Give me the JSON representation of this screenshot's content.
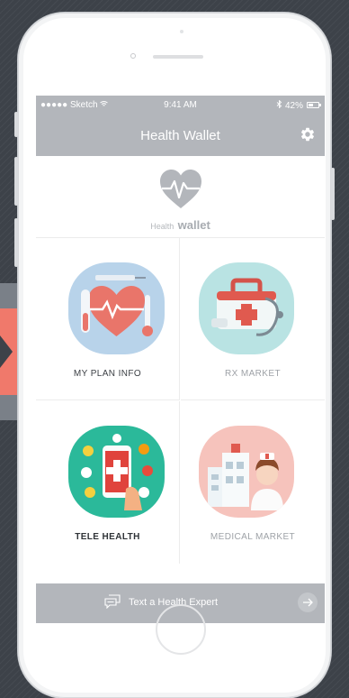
{
  "status_bar": {
    "carrier": "●●●●● Sketch",
    "wifi_icon": "wifi-icon",
    "time": "9:41 AM",
    "battery": "42%"
  },
  "nav": {
    "title": "Health Wallet",
    "settings_icon": "gear-icon"
  },
  "brand": {
    "prefix": "Health",
    "name": "wallet"
  },
  "menu": [
    {
      "label": "MY PLAN INFO",
      "icon": "plan-info-illustration",
      "bg": "#b8d3ea"
    },
    {
      "label": "RX MARKET",
      "icon": "medical-kit-illustration",
      "bg": "#b9e3e3"
    },
    {
      "label": "TELE HEALTH",
      "icon": "telehealth-phone-illustration",
      "bg": "#2bb99a"
    },
    {
      "label": "MEDICAL MARKET",
      "icon": "nurse-hospital-illustration",
      "bg": "#f6c3bc"
    }
  ],
  "colors": {
    "bar": "#b3b6bb",
    "accent": "#f0796b",
    "label_dark": "#3b3f44",
    "label_light": "#9ea2a7"
  },
  "footer": {
    "text": "Text a Health Expert",
    "chat_icon": "chat-icon",
    "arrow_icon": "arrow-right-icon"
  }
}
